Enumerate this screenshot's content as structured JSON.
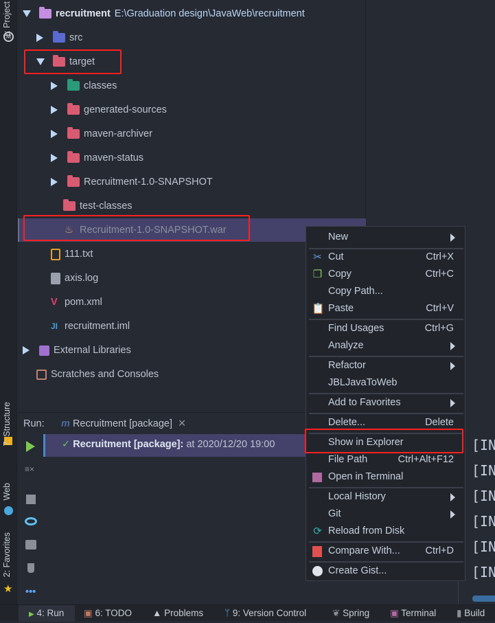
{
  "side_tabs": {
    "project": "1: Project",
    "structure": "7: Structure",
    "web": "Web",
    "favorites": "2: Favorites"
  },
  "tree": {
    "root": {
      "name": "recruitment",
      "path": "E:\\Graduation design\\JavaWeb\\recruitment"
    },
    "items": [
      {
        "label": "src"
      },
      {
        "label": "target"
      },
      {
        "label": "classes"
      },
      {
        "label": "generated-sources"
      },
      {
        "label": "maven-archiver"
      },
      {
        "label": "maven-status"
      },
      {
        "label": "Recruitment-1.0-SNAPSHOT"
      },
      {
        "label": "test-classes"
      },
      {
        "label": "Recruitment-1.0-SNAPSHOT.war"
      },
      {
        "label": "111.txt"
      },
      {
        "label": "axis.log"
      },
      {
        "label": "pom.xml"
      },
      {
        "label": "recruitment.iml"
      },
      {
        "label": "External Libraries"
      },
      {
        "label": "Scratches and Consoles"
      }
    ]
  },
  "run": {
    "label": "Run:",
    "tab": "Recruitment [package]",
    "entry_bold": "Recruitment [package]:",
    "entry_rest": " at 2020/12/20 19:00"
  },
  "menu": [
    {
      "label": "New"
    },
    {
      "label": "Cut",
      "shortcut": "Ctrl+X"
    },
    {
      "label": "Copy",
      "shortcut": "Ctrl+C"
    },
    {
      "label": "Copy Path..."
    },
    {
      "label": "Paste",
      "shortcut": "Ctrl+V"
    },
    {
      "label": "Find Usages",
      "shortcut": "Ctrl+G"
    },
    {
      "label": "Analyze"
    },
    {
      "label": "Refactor"
    },
    {
      "label": "JBLJavaToWeb"
    },
    {
      "label": "Add to Favorites"
    },
    {
      "label": "Delete...",
      "shortcut": "Delete"
    },
    {
      "label": "Show in Explorer"
    },
    {
      "label": "File Path",
      "shortcut": "Ctrl+Alt+F12"
    },
    {
      "label": "Open in Terminal"
    },
    {
      "label": "Local History"
    },
    {
      "label": "Git"
    },
    {
      "label": "Reload from Disk"
    },
    {
      "label": "Compare With...",
      "shortcut": "Ctrl+D"
    },
    {
      "label": "Create Gist..."
    }
  ],
  "console_lines": [
    "[IN",
    "[IN",
    "[IN",
    "[IN",
    "[IN",
    "[IN"
  ],
  "bottom": {
    "run": "4: Run",
    "todo": "6: TODO",
    "problems": "Problems",
    "vcs": "9: Version Control",
    "spring": "Spring",
    "terminal": "Terminal",
    "build": "Build"
  }
}
